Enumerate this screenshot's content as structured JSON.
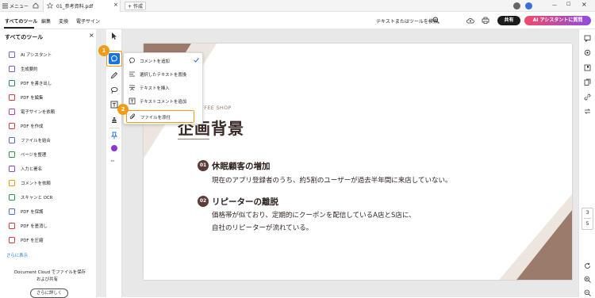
{
  "titlebar": {
    "menu_label": "メニュー",
    "tab_title": "01_参考資料.pdf",
    "new_tab_label": "作成"
  },
  "menubar": {
    "items": [
      "すべてのツール",
      "編集",
      "変換",
      "電子サイン"
    ],
    "search_label": "テキストまたはツールを検索",
    "share_label": "共有",
    "ai_label": "AI アシスタントに質問"
  },
  "panel": {
    "title": "すべてのツール",
    "tools": [
      {
        "label": "AI アシスタント",
        "color": "#7b5cd6"
      },
      {
        "label": "生成要約",
        "color": "#7b5cd6"
      },
      {
        "label": "PDF を書き出し",
        "color": "#2a8a63"
      },
      {
        "label": "PDF を編集",
        "color": "#d83b3b"
      },
      {
        "label": "電子サインを依頼",
        "color": "#b03fb8"
      },
      {
        "label": "PDF を作成",
        "color": "#d83b3b"
      },
      {
        "label": "ファイルを結合",
        "color": "#5b6bd6"
      },
      {
        "label": "ページを整理",
        "color": "#2a9a48"
      },
      {
        "label": "入力と署名",
        "color": "#8b4cc8"
      },
      {
        "label": "コメントを依頼",
        "color": "#e6a000"
      },
      {
        "label": "スキャンと OCR",
        "color": "#2a9a48"
      },
      {
        "label": "PDF を保護",
        "color": "#5b6bd6"
      },
      {
        "label": "PDF を墨消し",
        "color": "#d83b3b"
      },
      {
        "label": "PDF を圧縮",
        "color": "#d83b3b"
      }
    ],
    "more_label": "さらに表示",
    "cloud_line1": "Document Cloud でファイルを保存",
    "cloud_line2": "および共有",
    "detail_button": "さらに詳しく"
  },
  "popup": {
    "items": [
      "コメントを追加",
      "選択したテキストを置換",
      "テキストを挿入",
      "テキストコメントを追加",
      "ファイルを添付"
    ],
    "checked_index": 0,
    "highlight_index": 4
  },
  "badges": [
    "1",
    "2"
  ],
  "document": {
    "eyebrow": "NICE COFFEE SHOP",
    "title": "企画背景",
    "sections": [
      {
        "num": "01",
        "heading": "休眠顧客の増加",
        "lines": [
          "現在のアプリ登録者のうち、約5割のユーザーが過去半年間に来店していない。"
        ]
      },
      {
        "num": "02",
        "heading": "リピーターの離脱",
        "lines": [
          "価格帯が似ており、定期的にクーポンを配信しているA店とS店に、",
          "自社のリピーターが流れている。"
        ]
      }
    ]
  },
  "page_indicator": {
    "current": "3",
    "total": "5"
  },
  "colors": {
    "accent_brown": "#9b7c6a",
    "number_circle": "#5a3d36",
    "ai_gradient_start": "#f04b6a",
    "ai_gradient_end": "#8e4be0",
    "highlight_orange": "#f39c12",
    "selected_tool_blue": "#1473e6"
  }
}
